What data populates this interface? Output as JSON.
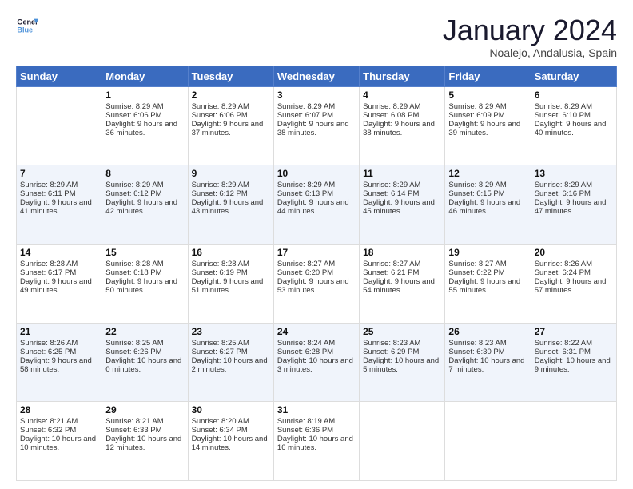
{
  "logo": {
    "text_general": "General",
    "text_blue": "Blue"
  },
  "header": {
    "month": "January 2024",
    "location": "Noalejo, Andalusia, Spain"
  },
  "days_of_week": [
    "Sunday",
    "Monday",
    "Tuesday",
    "Wednesday",
    "Thursday",
    "Friday",
    "Saturday"
  ],
  "weeks": [
    [
      {
        "day": "",
        "sunrise": "",
        "sunset": "",
        "daylight": ""
      },
      {
        "day": "1",
        "sunrise": "Sunrise: 8:29 AM",
        "sunset": "Sunset: 6:06 PM",
        "daylight": "Daylight: 9 hours and 36 minutes."
      },
      {
        "day": "2",
        "sunrise": "Sunrise: 8:29 AM",
        "sunset": "Sunset: 6:06 PM",
        "daylight": "Daylight: 9 hours and 37 minutes."
      },
      {
        "day": "3",
        "sunrise": "Sunrise: 8:29 AM",
        "sunset": "Sunset: 6:07 PM",
        "daylight": "Daylight: 9 hours and 38 minutes."
      },
      {
        "day": "4",
        "sunrise": "Sunrise: 8:29 AM",
        "sunset": "Sunset: 6:08 PM",
        "daylight": "Daylight: 9 hours and 38 minutes."
      },
      {
        "day": "5",
        "sunrise": "Sunrise: 8:29 AM",
        "sunset": "Sunset: 6:09 PM",
        "daylight": "Daylight: 9 hours and 39 minutes."
      },
      {
        "day": "6",
        "sunrise": "Sunrise: 8:29 AM",
        "sunset": "Sunset: 6:10 PM",
        "daylight": "Daylight: 9 hours and 40 minutes."
      }
    ],
    [
      {
        "day": "7",
        "sunrise": "Sunrise: 8:29 AM",
        "sunset": "Sunset: 6:11 PM",
        "daylight": "Daylight: 9 hours and 41 minutes."
      },
      {
        "day": "8",
        "sunrise": "Sunrise: 8:29 AM",
        "sunset": "Sunset: 6:12 PM",
        "daylight": "Daylight: 9 hours and 42 minutes."
      },
      {
        "day": "9",
        "sunrise": "Sunrise: 8:29 AM",
        "sunset": "Sunset: 6:12 PM",
        "daylight": "Daylight: 9 hours and 43 minutes."
      },
      {
        "day": "10",
        "sunrise": "Sunrise: 8:29 AM",
        "sunset": "Sunset: 6:13 PM",
        "daylight": "Daylight: 9 hours and 44 minutes."
      },
      {
        "day": "11",
        "sunrise": "Sunrise: 8:29 AM",
        "sunset": "Sunset: 6:14 PM",
        "daylight": "Daylight: 9 hours and 45 minutes."
      },
      {
        "day": "12",
        "sunrise": "Sunrise: 8:29 AM",
        "sunset": "Sunset: 6:15 PM",
        "daylight": "Daylight: 9 hours and 46 minutes."
      },
      {
        "day": "13",
        "sunrise": "Sunrise: 8:29 AM",
        "sunset": "Sunset: 6:16 PM",
        "daylight": "Daylight: 9 hours and 47 minutes."
      }
    ],
    [
      {
        "day": "14",
        "sunrise": "Sunrise: 8:28 AM",
        "sunset": "Sunset: 6:17 PM",
        "daylight": "Daylight: 9 hours and 49 minutes."
      },
      {
        "day": "15",
        "sunrise": "Sunrise: 8:28 AM",
        "sunset": "Sunset: 6:18 PM",
        "daylight": "Daylight: 9 hours and 50 minutes."
      },
      {
        "day": "16",
        "sunrise": "Sunrise: 8:28 AM",
        "sunset": "Sunset: 6:19 PM",
        "daylight": "Daylight: 9 hours and 51 minutes."
      },
      {
        "day": "17",
        "sunrise": "Sunrise: 8:27 AM",
        "sunset": "Sunset: 6:20 PM",
        "daylight": "Daylight: 9 hours and 53 minutes."
      },
      {
        "day": "18",
        "sunrise": "Sunrise: 8:27 AM",
        "sunset": "Sunset: 6:21 PM",
        "daylight": "Daylight: 9 hours and 54 minutes."
      },
      {
        "day": "19",
        "sunrise": "Sunrise: 8:27 AM",
        "sunset": "Sunset: 6:22 PM",
        "daylight": "Daylight: 9 hours and 55 minutes."
      },
      {
        "day": "20",
        "sunrise": "Sunrise: 8:26 AM",
        "sunset": "Sunset: 6:24 PM",
        "daylight": "Daylight: 9 hours and 57 minutes."
      }
    ],
    [
      {
        "day": "21",
        "sunrise": "Sunrise: 8:26 AM",
        "sunset": "Sunset: 6:25 PM",
        "daylight": "Daylight: 9 hours and 58 minutes."
      },
      {
        "day": "22",
        "sunrise": "Sunrise: 8:25 AM",
        "sunset": "Sunset: 6:26 PM",
        "daylight": "Daylight: 10 hours and 0 minutes."
      },
      {
        "day": "23",
        "sunrise": "Sunrise: 8:25 AM",
        "sunset": "Sunset: 6:27 PM",
        "daylight": "Daylight: 10 hours and 2 minutes."
      },
      {
        "day": "24",
        "sunrise": "Sunrise: 8:24 AM",
        "sunset": "Sunset: 6:28 PM",
        "daylight": "Daylight: 10 hours and 3 minutes."
      },
      {
        "day": "25",
        "sunrise": "Sunrise: 8:23 AM",
        "sunset": "Sunset: 6:29 PM",
        "daylight": "Daylight: 10 hours and 5 minutes."
      },
      {
        "day": "26",
        "sunrise": "Sunrise: 8:23 AM",
        "sunset": "Sunset: 6:30 PM",
        "daylight": "Daylight: 10 hours and 7 minutes."
      },
      {
        "day": "27",
        "sunrise": "Sunrise: 8:22 AM",
        "sunset": "Sunset: 6:31 PM",
        "daylight": "Daylight: 10 hours and 9 minutes."
      }
    ],
    [
      {
        "day": "28",
        "sunrise": "Sunrise: 8:21 AM",
        "sunset": "Sunset: 6:32 PM",
        "daylight": "Daylight: 10 hours and 10 minutes."
      },
      {
        "day": "29",
        "sunrise": "Sunrise: 8:21 AM",
        "sunset": "Sunset: 6:33 PM",
        "daylight": "Daylight: 10 hours and 12 minutes."
      },
      {
        "day": "30",
        "sunrise": "Sunrise: 8:20 AM",
        "sunset": "Sunset: 6:34 PM",
        "daylight": "Daylight: 10 hours and 14 minutes."
      },
      {
        "day": "31",
        "sunrise": "Sunrise: 8:19 AM",
        "sunset": "Sunset: 6:36 PM",
        "daylight": "Daylight: 10 hours and 16 minutes."
      },
      {
        "day": "",
        "sunrise": "",
        "sunset": "",
        "daylight": ""
      },
      {
        "day": "",
        "sunrise": "",
        "sunset": "",
        "daylight": ""
      },
      {
        "day": "",
        "sunrise": "",
        "sunset": "",
        "daylight": ""
      }
    ]
  ]
}
